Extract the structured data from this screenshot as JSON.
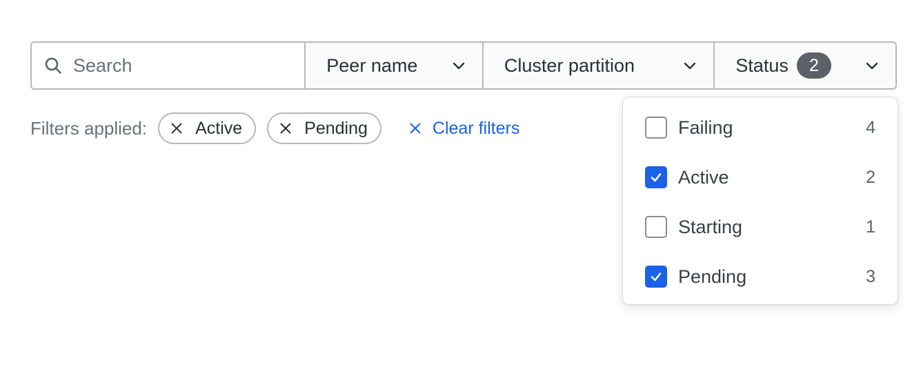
{
  "search": {
    "placeholder": "Search"
  },
  "filters": {
    "peer_name": {
      "label": "Peer name"
    },
    "cluster_partition": {
      "label": "Cluster partition"
    },
    "status": {
      "label": "Status",
      "count": "2"
    }
  },
  "applied": {
    "label": "Filters applied:",
    "chips": [
      {
        "label": "Active"
      },
      {
        "label": "Pending"
      }
    ],
    "clear_label": "Clear filters"
  },
  "status_menu": {
    "items": [
      {
        "label": "Failing",
        "count": "4",
        "checked": false
      },
      {
        "label": "Active",
        "count": "2",
        "checked": true
      },
      {
        "label": "Starting",
        "count": "1",
        "checked": false
      },
      {
        "label": "Pending",
        "count": "3",
        "checked": true
      }
    ]
  },
  "colors": {
    "accent": "#1a62e8",
    "border": "#b7b9bf",
    "badge": "#5c6068"
  },
  "icons": {
    "search": "search-icon",
    "chevron": "chevron-down-icon",
    "remove": "close-icon",
    "check": "check-icon"
  }
}
